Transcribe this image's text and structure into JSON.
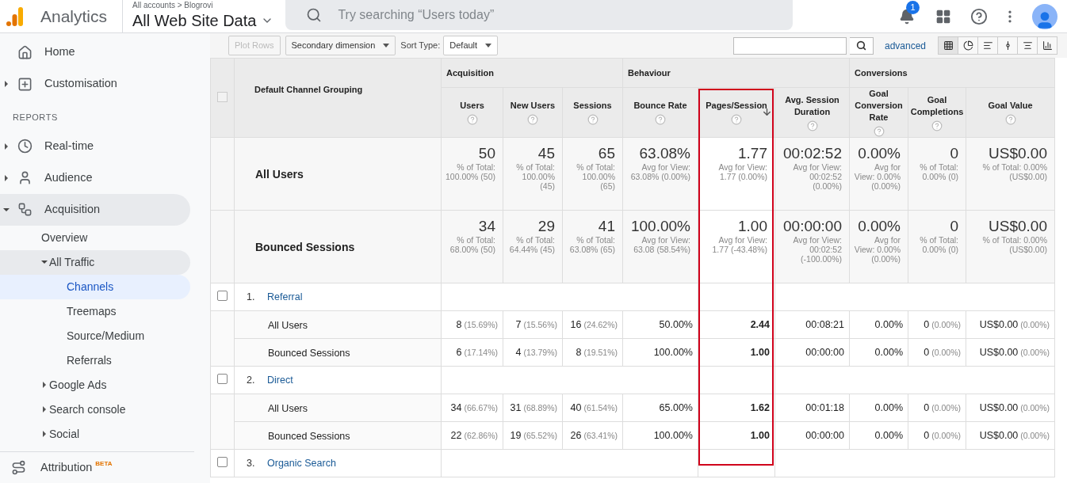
{
  "header": {
    "app_name": "Analytics",
    "breadcrumb": "All accounts > Blogrovi",
    "view_name": "All Web Site Data",
    "search_placeholder": "Try searching “Users today”",
    "notification_count": "1"
  },
  "sidebar": {
    "top": [
      {
        "label": "Home",
        "selected": false
      },
      {
        "label": "Customisation",
        "expanded": false,
        "selected": false
      }
    ],
    "section_label": "REPORTS",
    "reports": [
      {
        "label": "Real-time",
        "expanded": false,
        "selected": false
      },
      {
        "label": "Audience",
        "expanded": false,
        "selected": false
      },
      {
        "label": "Acquisition",
        "expanded": true,
        "selected": false,
        "children": [
          {
            "label": "Overview",
            "selected": false
          },
          {
            "label": "All Traffic",
            "expanded": true,
            "selected": false,
            "children": [
              {
                "label": "Channels",
                "selected": true
              },
              {
                "label": "Treemaps",
                "selected": false
              },
              {
                "label": "Source/Medium",
                "selected": false
              },
              {
                "label": "Referrals",
                "selected": false
              }
            ]
          },
          {
            "label": "Google Ads",
            "expanded": false,
            "selected": false
          },
          {
            "label": "Search console",
            "expanded": false,
            "selected": false
          },
          {
            "label": "Social",
            "expanded": false,
            "selected": false
          }
        ]
      }
    ],
    "footer": {
      "label": "Attribution",
      "badge": "BETA"
    }
  },
  "toolbar": {
    "plot_rows": {
      "label": "Plot Rows",
      "disabled": true
    },
    "secondary_dimension": "Secondary dimension",
    "sort_label": "Sort Type:",
    "sort_value": "Default",
    "advanced": "advanced",
    "views": [
      {
        "selected": true
      },
      {
        "selected": false
      },
      {
        "selected": false
      },
      {
        "selected": false
      },
      {
        "selected": false
      },
      {
        "selected": false
      }
    ]
  },
  "table": {
    "select_all_checked": false,
    "dimension_header": "Default Channel Grouping",
    "groups": [
      {
        "label": "Acquisition",
        "columns": [
          {
            "label": "Users",
            "sorted": false,
            "highlighted": false
          },
          {
            "label": "New Users",
            "sorted": false,
            "highlighted": false
          },
          {
            "label": "Sessions",
            "sorted": false,
            "highlighted": false
          }
        ]
      },
      {
        "label": "Behaviour",
        "columns": [
          {
            "label": "Bounce Rate",
            "sorted": false,
            "highlighted": false
          },
          {
            "label": "Pages/Session",
            "sorted": true,
            "highlighted": true
          },
          {
            "label": "Avg. Session Duration",
            "sorted": false,
            "highlighted": false
          }
        ]
      },
      {
        "label": "Conversions",
        "columns": [
          {
            "label": "Goal Conversion Rate",
            "sorted": false,
            "highlighted": false
          },
          {
            "label": "Goal Completions",
            "sorted": false,
            "highlighted": false
          },
          {
            "label": "Goal Value",
            "sorted": false,
            "highlighted": false
          }
        ]
      }
    ],
    "summary_rows": [
      {
        "label": "All Users",
        "cells": [
          {
            "value": "50",
            "note": "% of Total: 100.00% (50)"
          },
          {
            "value": "45",
            "note": "% of Total: 100.00% (45)"
          },
          {
            "value": "65",
            "note": "% of Total: 100.00% (65)"
          },
          {
            "value": "63.08%",
            "note": "Avg for View: 63.08% (0.00%)"
          },
          {
            "value": "1.77",
            "note": "Avg for View: 1.77 (0.00%)"
          },
          {
            "value": "00:02:52",
            "note": "Avg for View: 00:02:52 (0.00%)"
          },
          {
            "value": "0.00%",
            "note": "Avg for View: 0.00% (0.00%)"
          },
          {
            "value": "0",
            "note": "% of Total: 0.00% (0)"
          },
          {
            "value": "US$0.00",
            "note": "% of Total: 0.00% (US$0.00)"
          }
        ]
      },
      {
        "label": "Bounced Sessions",
        "cells": [
          {
            "value": "34",
            "note": "% of Total: 68.00% (50)"
          },
          {
            "value": "29",
            "note": "% of Total: 64.44% (45)"
          },
          {
            "value": "41",
            "note": "% of Total: 63.08% (65)"
          },
          {
            "value": "100.00%",
            "note": "Avg for View: 63.08 (58.54%)"
          },
          {
            "value": "1.00",
            "note": "Avg for View: 1.77 (-43.48%)"
          },
          {
            "value": "00:00:00",
            "note": "Avg for View: 00:02:52 (-100.00%)"
          },
          {
            "value": "0.00%",
            "note": "Avg for View: 0.00% (0.00%)"
          },
          {
            "value": "0",
            "note": "% of Total: 0.00% (0)"
          },
          {
            "value": "US$0.00",
            "note": "% of Total: 0.00% (US$0.00)"
          }
        ]
      }
    ],
    "channels": [
      {
        "index": "1.",
        "name": "Referral",
        "checked": false,
        "segments": [
          {
            "label": "All Users",
            "cells": [
              {
                "value": "8",
                "pct": "(15.69%)"
              },
              {
                "value": "7",
                "pct": "(15.56%)"
              },
              {
                "value": "16",
                "pct": "(24.62%)"
              },
              {
                "value": "50.00%"
              },
              {
                "value": "2.44"
              },
              {
                "value": "00:08:21"
              },
              {
                "value": "0.00%"
              },
              {
                "value": "0",
                "pct": "(0.00%)"
              },
              {
                "value": "US$0.00",
                "pct": "(0.00%)"
              }
            ]
          },
          {
            "label": "Bounced Sessions",
            "cells": [
              {
                "value": "6",
                "pct": "(17.14%)"
              },
              {
                "value": "4",
                "pct": "(13.79%)"
              },
              {
                "value": "8",
                "pct": "(19.51%)"
              },
              {
                "value": "100.00%"
              },
              {
                "value": "1.00"
              },
              {
                "value": "00:00:00"
              },
              {
                "value": "0.00%"
              },
              {
                "value": "0",
                "pct": "(0.00%)"
              },
              {
                "value": "US$0.00",
                "pct": "(0.00%)"
              }
            ]
          }
        ]
      },
      {
        "index": "2.",
        "name": "Direct",
        "checked": false,
        "segments": [
          {
            "label": "All Users",
            "cells": [
              {
                "value": "34",
                "pct": "(66.67%)"
              },
              {
                "value": "31",
                "pct": "(68.89%)"
              },
              {
                "value": "40",
                "pct": "(61.54%)"
              },
              {
                "value": "65.00%"
              },
              {
                "value": "1.62"
              },
              {
                "value": "00:01:18"
              },
              {
                "value": "0.00%"
              },
              {
                "value": "0",
                "pct": "(0.00%)"
              },
              {
                "value": "US$0.00",
                "pct": "(0.00%)"
              }
            ]
          },
          {
            "label": "Bounced Sessions",
            "cells": [
              {
                "value": "22",
                "pct": "(62.86%)"
              },
              {
                "value": "19",
                "pct": "(65.52%)"
              },
              {
                "value": "26",
                "pct": "(63.41%)"
              },
              {
                "value": "100.00%"
              },
              {
                "value": "1.00"
              },
              {
                "value": "00:00:00"
              },
              {
                "value": "0.00%"
              },
              {
                "value": "0",
                "pct": "(0.00%)"
              },
              {
                "value": "US$0.00",
                "pct": "(0.00%)"
              }
            ]
          }
        ]
      },
      {
        "index": "3.",
        "name": "Organic Search",
        "checked": false
      }
    ]
  }
}
